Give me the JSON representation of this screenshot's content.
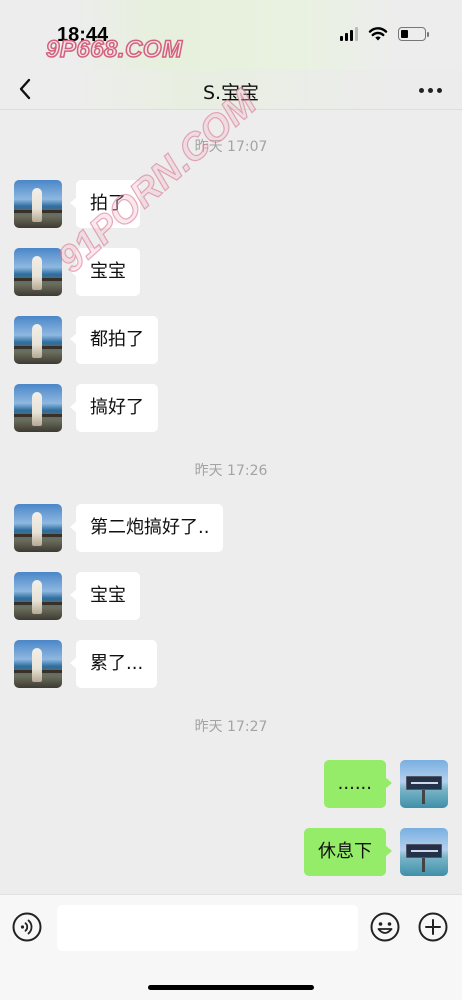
{
  "status_bar": {
    "time": "18:44",
    "watermark": "9P668.COM"
  },
  "header": {
    "back_icon": "chevron-left-icon",
    "title": "S.宝宝",
    "more_icon": "ellipsis-icon"
  },
  "overlay_watermark": "91PORN.COM",
  "chat": [
    {
      "type": "timestamp",
      "text": "昨天 17:07"
    },
    {
      "type": "message",
      "side": "left",
      "text": "拍了"
    },
    {
      "type": "message",
      "side": "left",
      "text": "宝宝"
    },
    {
      "type": "message",
      "side": "left",
      "text": "都拍了"
    },
    {
      "type": "message",
      "side": "left",
      "text": "搞好了"
    },
    {
      "type": "timestamp",
      "text": "昨天 17:26"
    },
    {
      "type": "message",
      "side": "left",
      "text": "第二炮搞好了.."
    },
    {
      "type": "message",
      "side": "left",
      "text": "宝宝"
    },
    {
      "type": "message",
      "side": "left",
      "text": "累了..."
    },
    {
      "type": "timestamp",
      "text": "昨天 17:27"
    },
    {
      "type": "message",
      "side": "right",
      "text": "......"
    },
    {
      "type": "message",
      "side": "right",
      "text": "休息下"
    }
  ],
  "input_bar": {
    "voice_icon": "voice-icon",
    "emoji_icon": "emoji-icon",
    "plus_icon": "plus-icon",
    "input_value": ""
  },
  "colors": {
    "background": "#ededed",
    "incoming_bubble": "#ffffff",
    "outgoing_bubble": "#95ec69",
    "timestamp": "#a3a3a3"
  }
}
